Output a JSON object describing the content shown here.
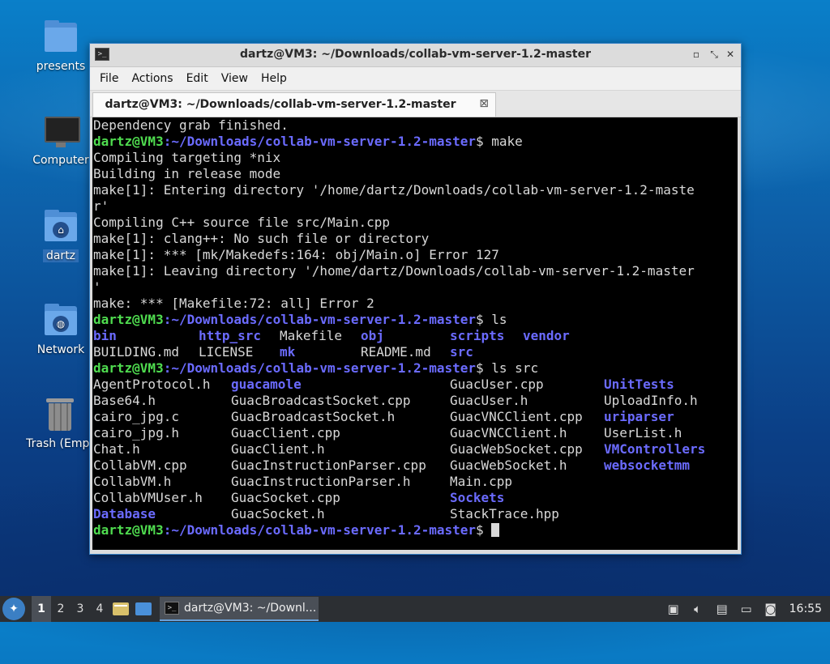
{
  "desktop": {
    "icons": [
      {
        "label": "presents",
        "icon": "folder-icon"
      },
      {
        "label": "Computer",
        "icon": "computer-icon"
      },
      {
        "label": "dartz",
        "icon": "home-folder-icon"
      },
      {
        "label": "Network",
        "icon": "network-folder-icon"
      },
      {
        "label": "Trash (Empt",
        "icon": "trash-icon"
      }
    ]
  },
  "window": {
    "title": "dartz@VM3: ~/Downloads/collab-vm-server-1.2-master",
    "controls": {
      "minimize": "▫",
      "maximize": "⤡",
      "close": "✕"
    },
    "menu": [
      "File",
      "Actions",
      "Edit",
      "View",
      "Help"
    ],
    "tab": {
      "label": "dartz@VM3: ~/Downloads/collab-vm-server-1.2-master",
      "close": "⊠"
    }
  },
  "terminal": {
    "prompt_user": "dartz@VM3",
    "prompt_path": ":~/Downloads/collab-vm-server-1.2-master",
    "lines": [
      "Dependency grab finished.",
      "$ make",
      "Compiling targeting *nix",
      "Building in release mode",
      "make[1]: Entering directory '/home/dartz/Downloads/collab-vm-server-1.2-maste",
      "r'",
      "Compiling C++ source file src/Main.cpp",
      "make[1]: clang++: No such file or directory",
      "make[1]: *** [mk/Makedefs:164: obj/Main.o] Error 127",
      "make[1]: Leaving directory '/home/dartz/Downloads/collab-vm-server-1.2-master",
      "'",
      "make: *** [Makefile:72: all] Error 2",
      "$ ls",
      "$ ls src",
      "$ "
    ],
    "ls_root": [
      [
        "bin",
        "http_src",
        "Makefile",
        "obj",
        "scripts",
        "vendor"
      ],
      [
        "BUILDING.md",
        "LICENSE",
        "mk",
        "README.md",
        "src"
      ]
    ],
    "ls_src": [
      [
        "AgentProtocol.h",
        "guacamole",
        "GuacUser.cpp",
        "UnitTests"
      ],
      [
        "Base64.h",
        "GuacBroadcastSocket.cpp",
        "GuacUser.h",
        "UploadInfo.h"
      ],
      [
        "cairo_jpg.c",
        "GuacBroadcastSocket.h",
        "GuacVNCClient.cpp",
        "uriparser"
      ],
      [
        "cairo_jpg.h",
        "GuacClient.cpp",
        "GuacVNCClient.h",
        "UserList.h"
      ],
      [
        "Chat.h",
        "GuacClient.h",
        "GuacWebSocket.cpp",
        "VMControllers"
      ],
      [
        "CollabVM.cpp",
        "GuacInstructionParser.cpp",
        "GuacWebSocket.h",
        "websocketmm"
      ],
      [
        "CollabVM.h",
        "GuacInstructionParser.h",
        "Main.cpp",
        ""
      ],
      [
        "CollabVMUser.h",
        "GuacSocket.cpp",
        "Sockets",
        ""
      ],
      [
        "Database",
        "GuacSocket.h",
        "StackTrace.hpp",
        ""
      ]
    ]
  },
  "taskbar": {
    "workspaces": [
      "1",
      "2",
      "3",
      "4"
    ],
    "task_label": "dartz@VM3: ~/Downl...",
    "clock": "16:55"
  }
}
